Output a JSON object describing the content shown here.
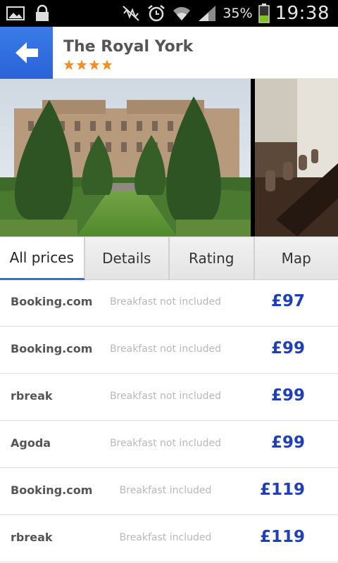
{
  "status_bar": {
    "battery_percent": "35%",
    "time": "19:38",
    "icons": [
      "gallery-icon",
      "lock-icon",
      "mute-icon",
      "alarm-icon",
      "wifi-icon",
      "signal-icon",
      "battery-icon"
    ]
  },
  "header": {
    "title": "The Royal York",
    "star_rating": 4,
    "star_color": "#f0902a",
    "back_color": "#2f6fe6"
  },
  "tabs": [
    {
      "label": "All prices",
      "active": true
    },
    {
      "label": "Details",
      "active": false
    },
    {
      "label": "Rating",
      "active": false
    },
    {
      "label": "Map",
      "active": false
    }
  ],
  "prices": [
    {
      "provider": "Booking.com",
      "breakfast": "Breakfast not included",
      "price": "£97"
    },
    {
      "provider": "Booking.com",
      "breakfast": "Breakfast not included",
      "price": "£99"
    },
    {
      "provider": "rbreak",
      "breakfast": "Breakfast not included",
      "price": "£99"
    },
    {
      "provider": "Agoda",
      "breakfast": "Breakfast not included",
      "price": "£99"
    },
    {
      "provider": "Booking.com",
      "breakfast": "Breakfast included",
      "price": "£119"
    },
    {
      "provider": "rbreak",
      "breakfast": "Breakfast included",
      "price": "£119"
    }
  ],
  "colors": {
    "price": "#1f3fb8",
    "accent": "#2f6fe6"
  }
}
